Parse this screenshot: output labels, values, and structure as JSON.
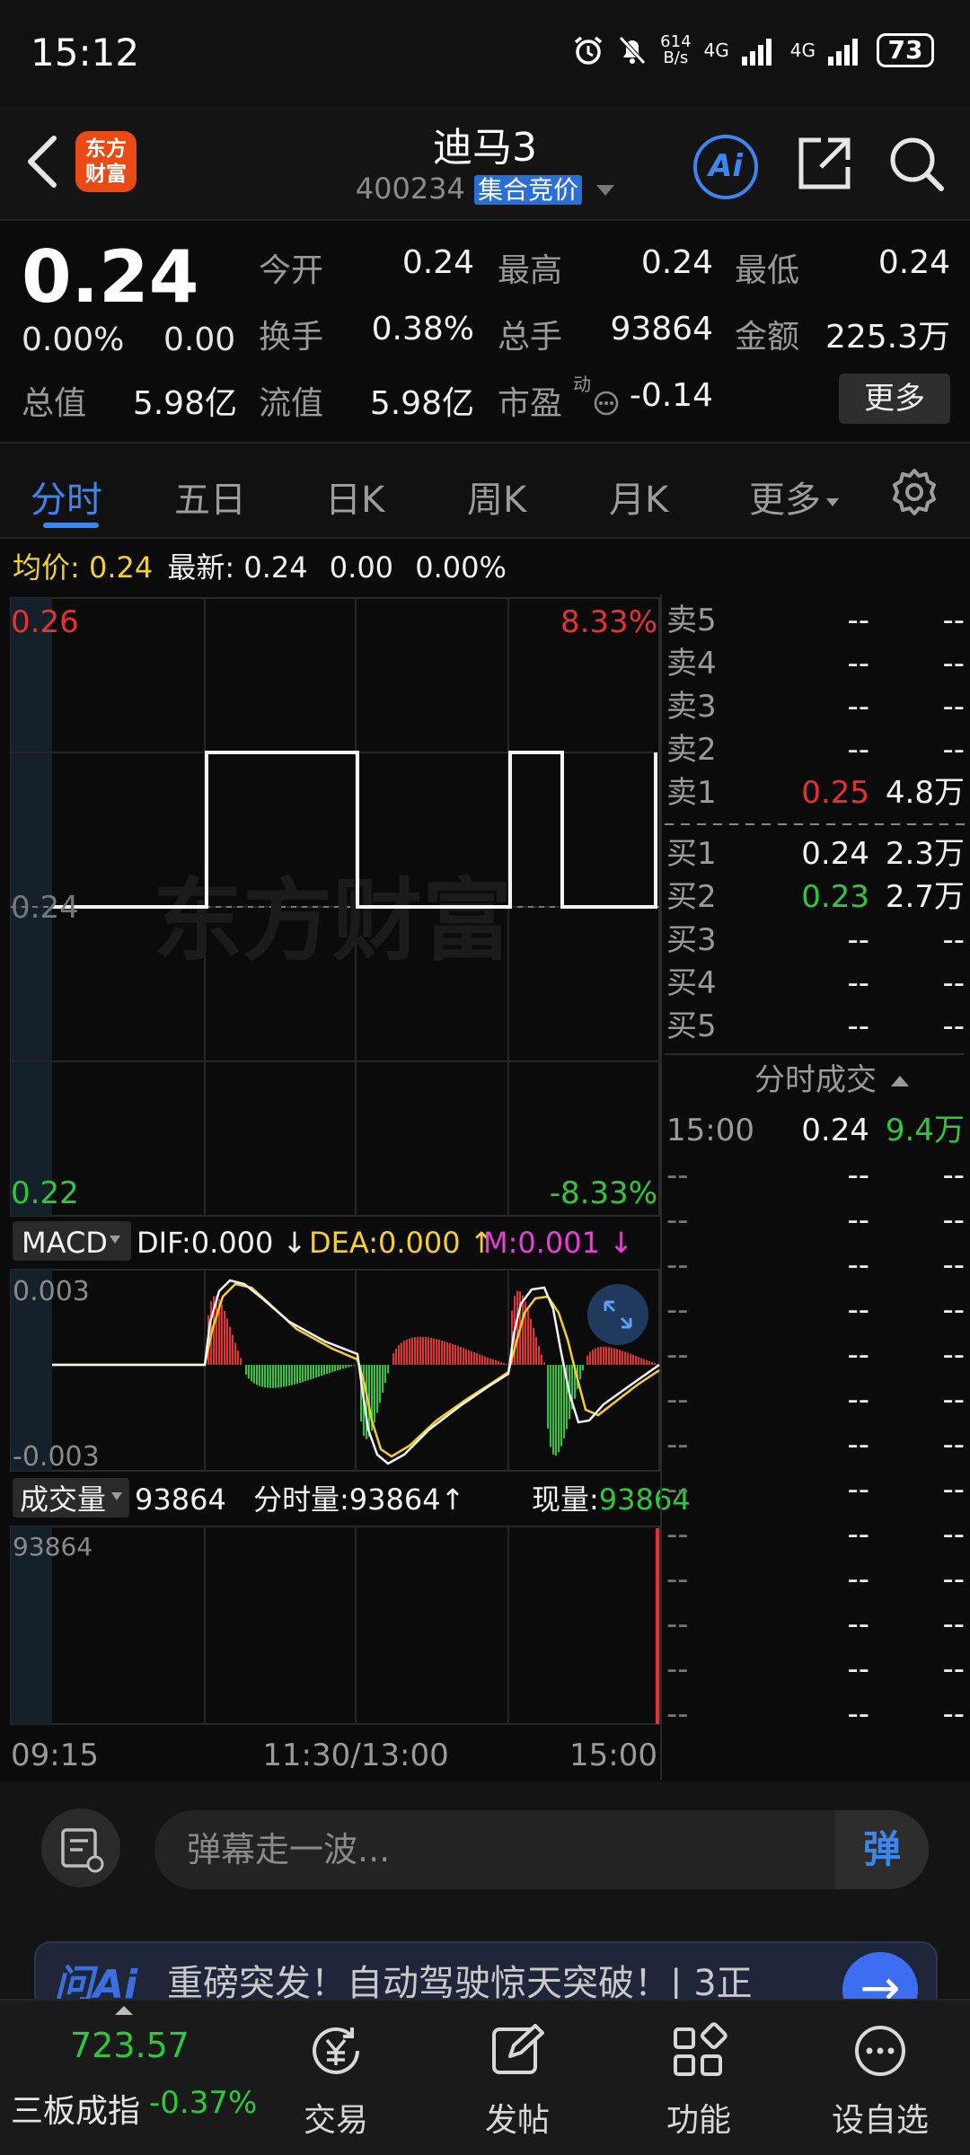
{
  "status": {
    "time": "15:12",
    "net_speed_top": "614",
    "net_speed_bottom": "B/s",
    "signal1": "4G",
    "signal2": "4G",
    "battery": "73"
  },
  "nav": {
    "title": "迪马3",
    "code": "400234",
    "badge": "集合竞价",
    "logo_line1": "东方",
    "logo_line2": "财富",
    "ai_label": "Ai"
  },
  "quote": {
    "price": "0.24",
    "change_pct": "0.00%",
    "change": "0.00",
    "more_button": "更多",
    "fields": [
      {
        "label": "今开",
        "value": "0.24"
      },
      {
        "label": "最高",
        "value": "0.24"
      },
      {
        "label": "最低",
        "value": "0.24"
      },
      {
        "label": "换手",
        "value": "0.38%"
      },
      {
        "label": "总手",
        "value": "93864"
      },
      {
        "label": "金额",
        "value": "225.3万"
      },
      {
        "label": "总值",
        "value": "5.98亿"
      },
      {
        "label": "流值",
        "value": "5.98亿"
      },
      {
        "label": "市盈",
        "value": "-0.14"
      }
    ],
    "pe_superscript": "动"
  },
  "tabs": [
    "分时",
    "五日",
    "日K",
    "周K",
    "月K",
    "更多"
  ],
  "avg": {
    "avg_label": "均价:",
    "avg_value": "0.24",
    "latest_label": "最新:",
    "latest_value": "0.24",
    "latest_change": "0.00",
    "latest_pct": "0.00%"
  },
  "price_chart": {
    "top_price": "0.26",
    "top_pct": "8.33%",
    "mid_price": "0.24",
    "bottom_price": "0.22",
    "bottom_pct": "-8.33%",
    "watermark": "东方财富"
  },
  "macd": {
    "selector": "MACD",
    "dif": "DIF:0.000",
    "dea": "DEA:0.000",
    "m": "M:0.001",
    "top": "0.003",
    "bottom": "-0.003"
  },
  "volume": {
    "selector": "成交量",
    "total": "93864",
    "minute_label": "分时量:",
    "minute_value": "93864",
    "now_label": "现量:",
    "now_value": "93864",
    "axis_top": "93864"
  },
  "time_axis": [
    "09:15",
    "11:30/13:00",
    "15:00"
  ],
  "order_book": {
    "asks": [
      {
        "label": "卖5",
        "price": "--",
        "vol": "--"
      },
      {
        "label": "卖4",
        "price": "--",
        "vol": "--"
      },
      {
        "label": "卖3",
        "price": "--",
        "vol": "--"
      },
      {
        "label": "卖2",
        "price": "--",
        "vol": "--"
      },
      {
        "label": "卖1",
        "price": "0.25",
        "vol": "4.8万"
      }
    ],
    "bids": [
      {
        "label": "买1",
        "price": "0.24",
        "vol": "2.3万"
      },
      {
        "label": "买2",
        "price": "0.23",
        "vol": "2.7万"
      },
      {
        "label": "买3",
        "price": "--",
        "vol": "--"
      },
      {
        "label": "买4",
        "price": "--",
        "vol": "--"
      },
      {
        "label": "买5",
        "price": "--",
        "vol": "--"
      }
    ],
    "trades_header": "分时成交",
    "trades": [
      {
        "time": "15:00",
        "price": "0.24",
        "vol": "9.4万"
      },
      {
        "time": "--",
        "price": "--",
        "vol": "--"
      },
      {
        "time": "--",
        "price": "--",
        "vol": "--"
      },
      {
        "time": "--",
        "price": "--",
        "vol": "--"
      },
      {
        "time": "--",
        "price": "--",
        "vol": "--"
      },
      {
        "time": "--",
        "price": "--",
        "vol": "--"
      },
      {
        "time": "--",
        "price": "--",
        "vol": "--"
      },
      {
        "time": "--",
        "price": "--",
        "vol": "--"
      },
      {
        "time": "--",
        "price": "--",
        "vol": "--"
      },
      {
        "time": "--",
        "price": "--",
        "vol": "--"
      },
      {
        "time": "--",
        "price": "--",
        "vol": "--"
      },
      {
        "time": "--",
        "price": "--",
        "vol": "--"
      },
      {
        "time": "--",
        "price": "--",
        "vol": "--"
      },
      {
        "time": "--",
        "price": "--",
        "vol": "--"
      }
    ]
  },
  "danmu": {
    "placeholder": "弹幕走一波...",
    "send": "弹"
  },
  "ad": {
    "brand": "问Ai",
    "text": "重磅突发！自动驾驶惊天突破！| 3正"
  },
  "bottombar": {
    "index_value": "723.57",
    "index_name": "三板成指",
    "index_change": "-0.37%",
    "items": [
      "交易",
      "发帖",
      "功能",
      "设自选"
    ]
  },
  "colors": {
    "up": "#e8312e",
    "down": "#2ec93a",
    "accent": "#3b86f0",
    "yellow": "#f5d02c",
    "magenta": "#ea3fd6"
  }
}
